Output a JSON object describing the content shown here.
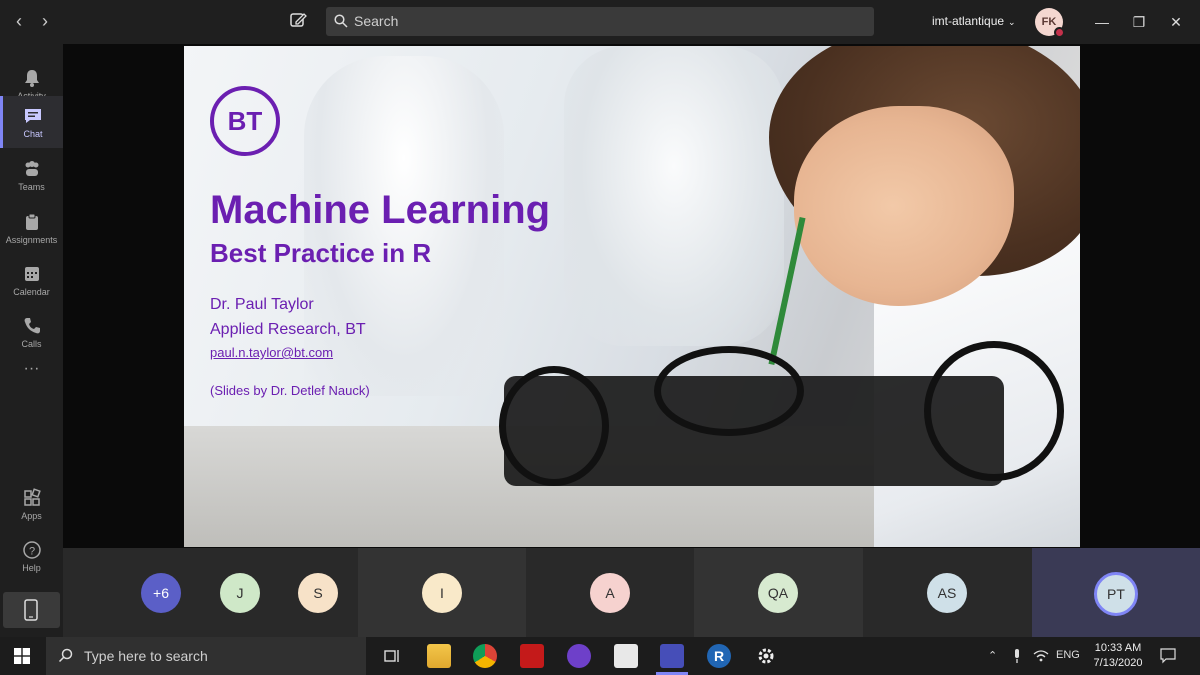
{
  "titlebar": {
    "search_placeholder": "Search",
    "tenant": "imt-atlantique",
    "user_initials": "FK",
    "status_color": "#c4314b"
  },
  "rail": {
    "items": [
      {
        "label": "Activity",
        "icon": "bell-icon"
      },
      {
        "label": "Chat",
        "icon": "chat-icon",
        "active": true
      },
      {
        "label": "Teams",
        "icon": "teams-icon"
      },
      {
        "label": "Assignments",
        "icon": "assignments-icon"
      },
      {
        "label": "Calendar",
        "icon": "calendar-icon"
      },
      {
        "label": "Calls",
        "icon": "phone-icon"
      },
      {
        "label": "Apps",
        "icon": "apps-icon"
      },
      {
        "label": "Help",
        "icon": "help-icon"
      }
    ],
    "accent": "#7f85f5"
  },
  "slide": {
    "logo": "BT",
    "title": "Machine Learning",
    "subtitle": "Best Practice in R",
    "author": "Dr. Paul Taylor",
    "affiliation": "Applied Research, BT",
    "email": "paul.n.taylor@bt.com",
    "credit": "(Slides by Dr. Detlef Nauck)",
    "brand_color": "#6b1fb1"
  },
  "participants": [
    {
      "initials": "+6",
      "color": "#5b5fc7",
      "text_color": "#ffffff"
    },
    {
      "initials": "J",
      "color": "#cfe8c8"
    },
    {
      "initials": "S",
      "color": "#f7e2c8"
    },
    {
      "initials": "I",
      "color": "#f9e9c9"
    },
    {
      "initials": "A",
      "color": "#f6d2cf"
    },
    {
      "initials": "QA",
      "color": "#d7ead0"
    },
    {
      "initials": "AS",
      "color": "#cfe0e8"
    },
    {
      "initials": "PT",
      "color": "#cfe0e8",
      "active": true
    }
  ],
  "taskbar": {
    "search_placeholder": "Type here to search",
    "language": "ENG",
    "time": "10:33 AM",
    "date": "7/13/2020"
  }
}
